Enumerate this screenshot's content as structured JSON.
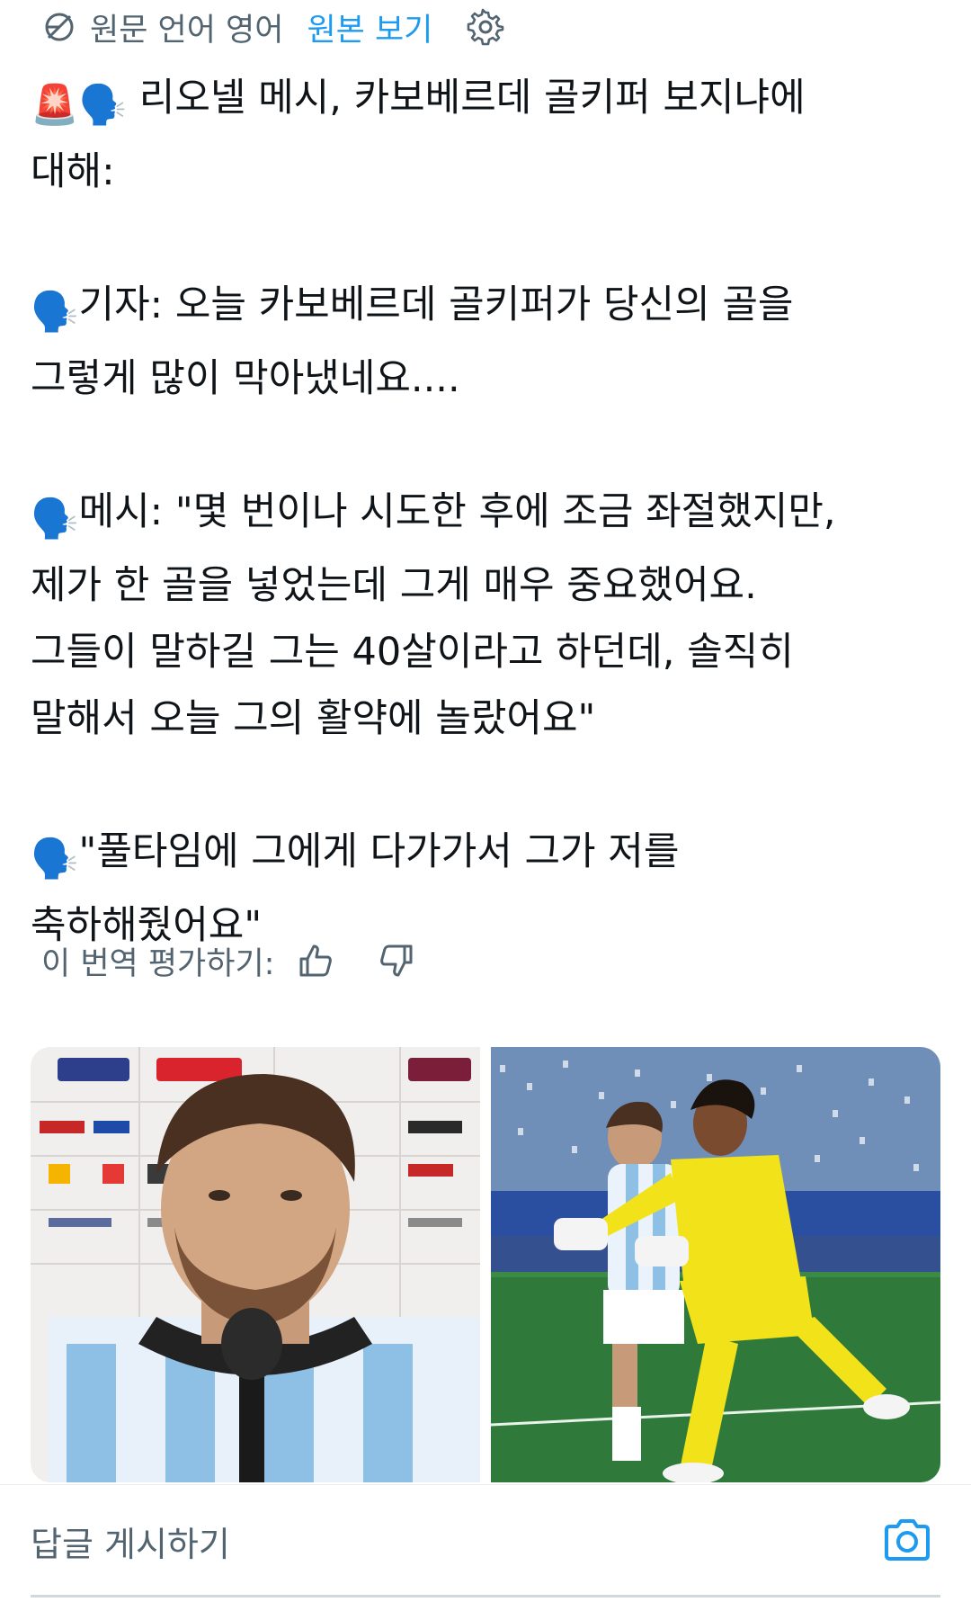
{
  "translation": {
    "label": "원문 언어 영어",
    "show_original": "원본 보기"
  },
  "tweet": {
    "paragraphs": [
      {
        "lines": [
          {
            "prefix": "🚨🗣️",
            "text": " 리오넬 메시, 카보베르데 골키퍼 보지냐에"
          },
          {
            "prefix": "",
            "text": "대해:"
          }
        ]
      },
      {
        "lines": [
          {
            "prefix": "🗣️",
            "text": "기자: 오늘 카보베르데 골키퍼가 당신의 골을"
          },
          {
            "prefix": "",
            "text": "그렇게 많이 막아냈네요...."
          }
        ]
      },
      {
        "lines": [
          {
            "prefix": "🗣️",
            "text": "메시: \"몇 번이나 시도한 후에 조금 좌절했지만,"
          },
          {
            "prefix": "",
            "text": "제가 한 골을 넣었는데 그게 매우 중요했어요."
          },
          {
            "prefix": "",
            "text": "그들이 말하길 그는 40살이라고 하던데, 솔직히"
          },
          {
            "prefix": "",
            "text": "말해서 오늘 그의 활약에 놀랐어요\""
          }
        ]
      },
      {
        "lines": [
          {
            "prefix": "🗣️",
            "text": "\"풀타임에 그에게 다가가서 그가 저를"
          },
          {
            "prefix": "",
            "text": "축하해줬어요\""
          }
        ]
      }
    ]
  },
  "rate": {
    "label": "이 번역 평가하기:"
  },
  "media": {
    "images": [
      {
        "name": "photo-messi-press-conference"
      },
      {
        "name": "photo-messi-vs-goalkeeper"
      }
    ]
  },
  "reply": {
    "placeholder": "답글 게시하기"
  },
  "icons": {
    "globe": "translate-globe-icon",
    "gear": "gear-icon",
    "like": "thumbs-up-icon",
    "dislike": "thumbs-down-icon",
    "camera": "camera-icon"
  },
  "colors": {
    "accent": "#1d9bf0",
    "text": "#0f1419",
    "secondary": "#536471",
    "goalkeeper_kit": "#f2e21a",
    "pitch": "#2f7a3a"
  }
}
